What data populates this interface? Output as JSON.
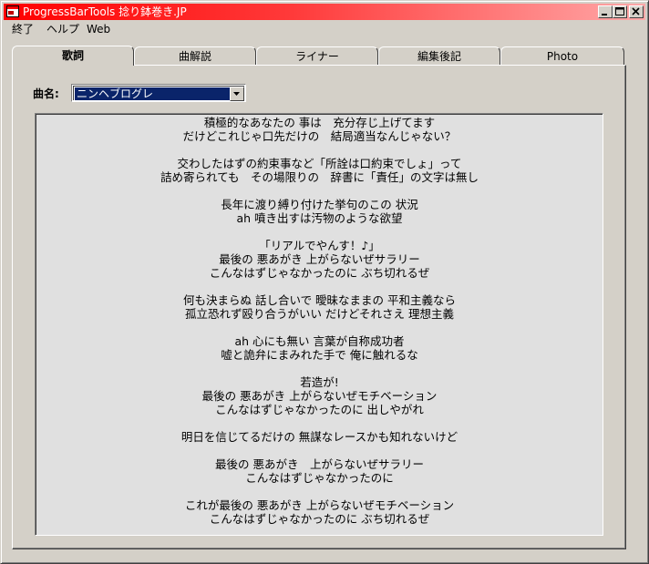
{
  "window": {
    "title": "ProgressBarTools 捻り鉢巻き.JP"
  },
  "menu": {
    "items": [
      "終了",
      "ヘルプ",
      "Web"
    ]
  },
  "tabs": [
    {
      "label": "歌詞",
      "active": true
    },
    {
      "label": "曲解説",
      "active": false
    },
    {
      "label": "ライナー",
      "active": false
    },
    {
      "label": "編集後記",
      "active": false
    },
    {
      "label": "Photo",
      "active": false
    }
  ],
  "song": {
    "label": "曲名:",
    "selected": "ニンヘブログレ"
  },
  "lyrics": [
    "積極的なあなたの 事は　充分存じ上げてます",
    "だけどこれじゃ口先だけの　結局適当なんじゃない？",
    "",
    "交わしたはずの約束事など「所詮は口約束でしょ」って",
    "詰め寄られても　その場限りの　辞書に「責任」の文字は無し",
    "",
    "長年に渡り縛り付けた挙句のこの 状況",
    "ah 噴き出すは汚物のような欲望",
    "",
    "「リアルでやんす！♪」",
    "最後の 悪あがき 上がらないぜサラリー",
    "こんなはずじゃなかったのに ぶち切れるぜ",
    "",
    "何も決まらぬ 話し合いで 曖昧なままの 平和主義なら",
    "孤立恐れず殴り合うがいい だけどそれさえ 理想主義",
    "",
    "ah 心にも無い 言葉が自称成功者",
    "嘘と詭弁にまみれた手で 俺に触れるな",
    "",
    "若造が!",
    "最後の 悪あがき 上がらないぜモチベーション",
    "こんなはずじゃなかったのに 出しやがれ",
    "",
    "明日を信じてるだけの 無謀なレースかも知れないけど",
    "",
    "最後の 悪あがき　上がらないぜサラリー",
    "こんなはずじゃなかったのに",
    "",
    "これが最後の 悪あがき 上がらないぜモチベーション",
    "こんなはずじゃなかったのに ぶち切れるぜ"
  ],
  "icons": {
    "app": "app-window-icon",
    "minimize": "minimize-icon",
    "maximize": "maximize-icon",
    "close": "close-icon",
    "dropdown": "chevron-down-icon"
  },
  "colors": {
    "titlebar": "#ff0000",
    "selection": "#0a246a",
    "face": "#d4d0c8",
    "lyrics_bg": "#e0e0e0"
  }
}
